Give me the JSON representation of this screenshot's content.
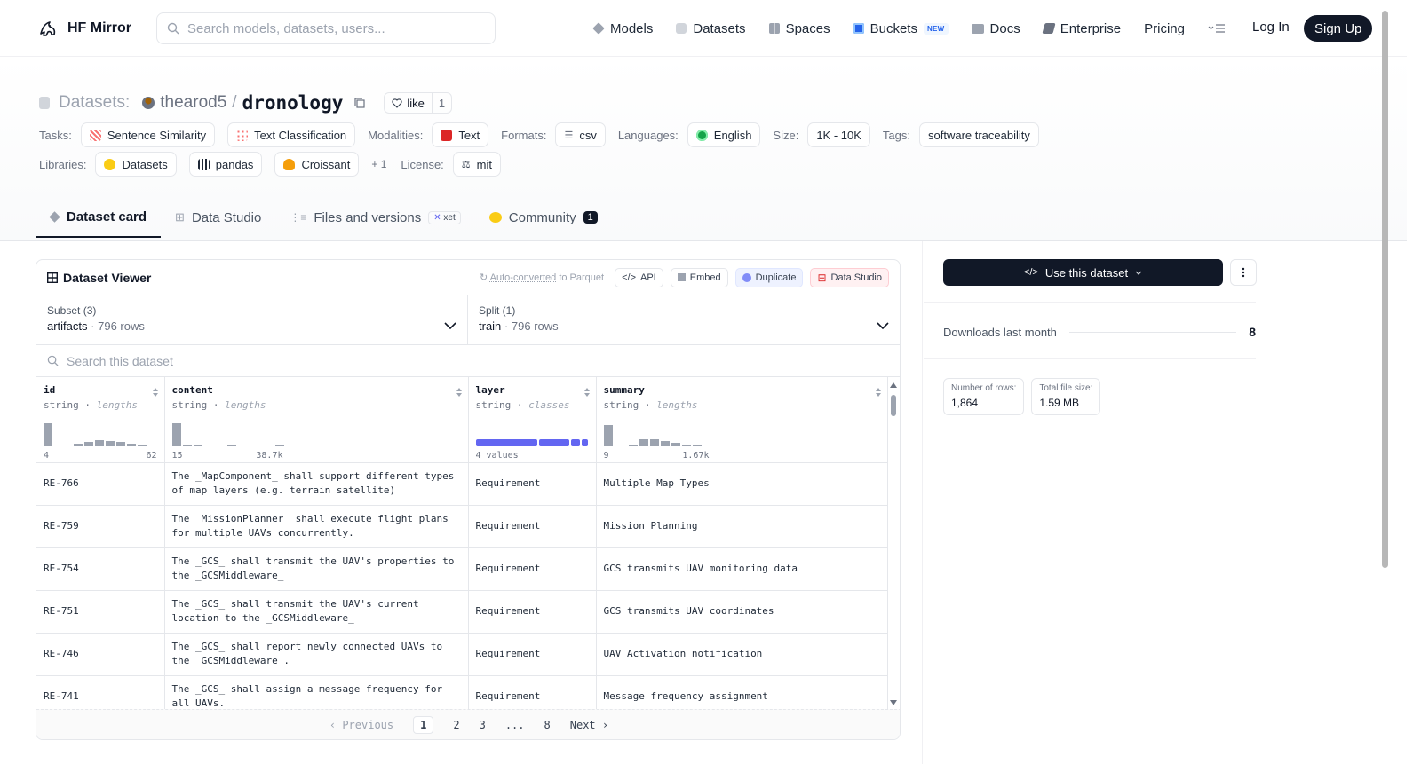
{
  "header": {
    "brand": "HF Mirror",
    "search_placeholder": "Search models, datasets, users...",
    "nav": [
      {
        "label": "Models",
        "icon": "cube-icon",
        "color": "#9ca3af"
      },
      {
        "label": "Datasets",
        "icon": "database-icon",
        "color": "#d1d5db"
      },
      {
        "label": "Spaces",
        "icon": "grid-icon",
        "color": "#9ca3af"
      },
      {
        "label": "Buckets",
        "icon": "bucket-icon",
        "color": "#2563eb",
        "badge": "NEW"
      },
      {
        "label": "Docs",
        "icon": "book-icon",
        "color": "#9ca3af"
      },
      {
        "label": "Enterprise",
        "icon": "building-icon",
        "color": "#6b7280"
      },
      {
        "label": "Pricing"
      }
    ],
    "login": "Log In",
    "signup": "Sign Up"
  },
  "repo": {
    "type_label": "Datasets:",
    "owner": "thearod5",
    "separator": "/",
    "name": "dronology",
    "like_label": "like",
    "like_count": "1"
  },
  "meta": {
    "tasks_label": "Tasks:",
    "tasks": [
      "Sentence Similarity",
      "Text Classification"
    ],
    "modalities_label": "Modalities:",
    "modality": "Text",
    "formats_label": "Formats:",
    "format": "csv",
    "languages_label": "Languages:",
    "language": "English",
    "size_label": "Size:",
    "size": "1K - 10K",
    "tags_label": "Tags:",
    "tag": "software traceability",
    "libraries_label": "Libraries:",
    "libraries": [
      "Datasets",
      "pandas",
      "Croissant"
    ],
    "libraries_more": "+ 1",
    "license_label": "License:",
    "license": "mit"
  },
  "tabs": [
    {
      "label": "Dataset card",
      "active": true
    },
    {
      "label": "Data Studio"
    },
    {
      "label": "Files and versions",
      "badge": "xet"
    },
    {
      "label": "Community",
      "count": "1"
    }
  ],
  "viewer": {
    "title": "Dataset Viewer",
    "auto_converted_pre": "Auto-converted",
    "auto_converted_post": " to Parquet",
    "api": "API",
    "embed": "Embed",
    "duplicate": "Duplicate",
    "data_studio": "Data Studio",
    "subset_label": "Subset (3)",
    "subset_value": "artifacts",
    "subset_rows": "796 rows",
    "split_label": "Split (1)",
    "split_value": "train",
    "split_rows": "796 rows",
    "search_placeholder": "Search this dataset",
    "columns": [
      {
        "name": "id",
        "type": "string",
        "stat": "lengths",
        "min": "4",
        "max": "62"
      },
      {
        "name": "content",
        "type": "string",
        "stat": "lengths",
        "min": "15",
        "max": "38.7k"
      },
      {
        "name": "layer",
        "type": "string",
        "stat": "classes",
        "min": "4 values",
        "max": ""
      },
      {
        "name": "summary",
        "type": "string",
        "stat": "lengths",
        "min": "9",
        "max": "1.67k"
      }
    ],
    "rows": [
      {
        "id": "RE-766",
        "content": "The _MapComponent_ shall support different types of map layers (e.g. terrain satellite)",
        "layer": "Requirement",
        "summary": "Multiple Map Types"
      },
      {
        "id": "RE-759",
        "content": "The _MissionPlanner_ shall execute flight plans for multiple UAVs concurrently.",
        "layer": "Requirement",
        "summary": "Mission Planning"
      },
      {
        "id": "RE-754",
        "content": "The _GCS_ shall transmit the UAV's properties to the _GCSMiddleware_",
        "layer": "Requirement",
        "summary": "GCS transmits UAV monitoring data"
      },
      {
        "id": "RE-751",
        "content": "The _GCS_ shall transmit the UAV's current location to the _GCSMiddleware_",
        "layer": "Requirement",
        "summary": "GCS transmits UAV coordinates"
      },
      {
        "id": "RE-746",
        "content": "The _GCS_ shall report newly connected UAVs to the _GCSMiddleware_.",
        "layer": "Requirement",
        "summary": "UAV Activation notification"
      },
      {
        "id": "RE-741",
        "content": "The _GCS_ shall assign a message frequency for all UAVs.",
        "layer": "Requirement",
        "summary": "Message frequency assignment"
      }
    ],
    "pager": {
      "prev": "Previous",
      "pages": [
        "1",
        "2",
        "3",
        "...",
        "8"
      ],
      "current": "1",
      "next": "Next"
    }
  },
  "sidebar": {
    "use_button": "Use this dataset",
    "downloads_label": "Downloads last month",
    "downloads_value": "8",
    "rows_label": "Number of rows:",
    "rows_value": "1,864",
    "size_label": "Total file size:",
    "size_value": "1.59 MB"
  }
}
